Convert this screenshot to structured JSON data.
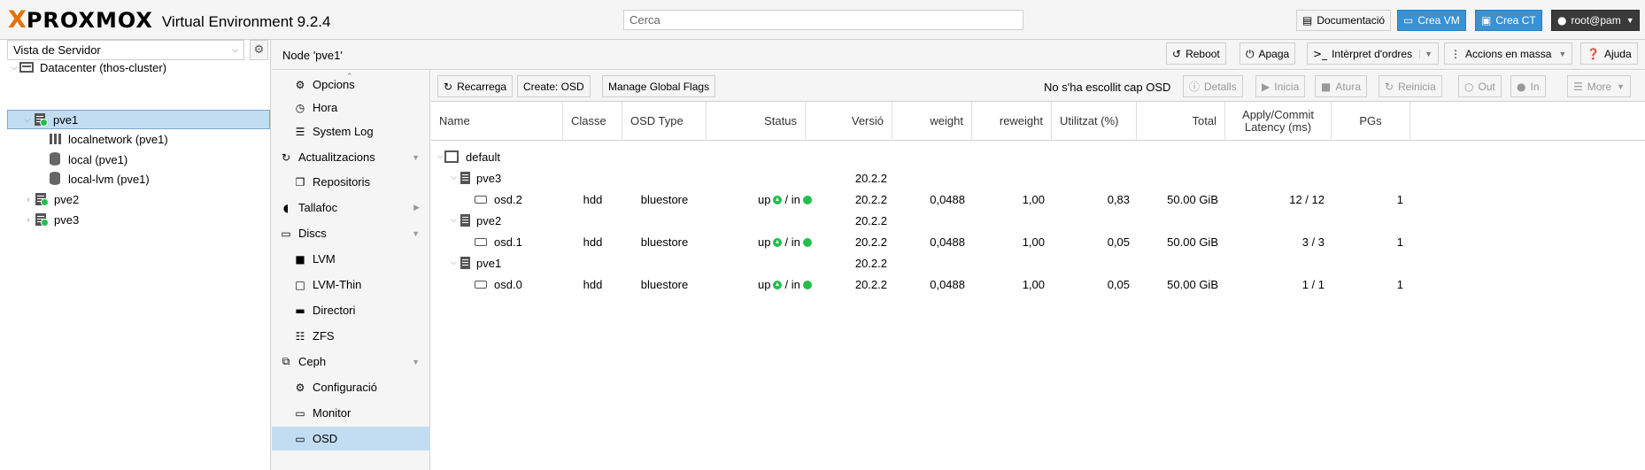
{
  "app": {
    "logo_x": "X",
    "logo_text": "PROXMOX",
    "version_label": "Virtual Environment 9.2.4"
  },
  "header": {
    "search_placeholder": "Cerca",
    "doc_label": "Documentació",
    "create_vm_label": "Crea VM",
    "create_ct_label": "Crea CT",
    "user_label": "root@pam"
  },
  "sidebar": {
    "view_label": "Vista de Servidor",
    "tree": [
      {
        "label": "Datacenter (thos-cluster)",
        "type": "datacenter"
      },
      {
        "label": "pve1",
        "type": "node",
        "selected": true
      },
      {
        "label": "localnetwork (pve1)",
        "type": "network"
      },
      {
        "label": "local (pve1)",
        "type": "storage"
      },
      {
        "label": "local-lvm (pve1)",
        "type": "storage"
      },
      {
        "label": "pve2",
        "type": "node"
      },
      {
        "label": "pve3",
        "type": "node"
      }
    ]
  },
  "node_header": {
    "title": "Node 'pve1'",
    "reboot_label": "Reboot",
    "shutdown_label": "Apaga",
    "shell_label": "Intèrpret d'ordres",
    "bulk_label": "Accions en massa",
    "help_label": "Ajuda"
  },
  "menu": {
    "items": [
      {
        "label": "Opcions",
        "icon": "gear-icon"
      },
      {
        "label": "Hora",
        "icon": "clock-icon"
      },
      {
        "label": "System Log",
        "icon": "list-icon"
      },
      {
        "label": "Actualitzacions",
        "icon": "refresh-icon"
      },
      {
        "label": "Repositoris",
        "icon": "files-icon"
      },
      {
        "label": "Tallafoc",
        "icon": "shield-icon"
      },
      {
        "label": "Discs",
        "icon": "hdd-icon"
      },
      {
        "label": "LVM",
        "icon": "square-icon"
      },
      {
        "label": "LVM-Thin",
        "icon": "square-outline-icon"
      },
      {
        "label": "Directori",
        "icon": "folder-icon"
      },
      {
        "label": "ZFS",
        "icon": "grid-icon"
      },
      {
        "label": "Ceph",
        "icon": "ceph-icon"
      },
      {
        "label": "Configuració",
        "icon": "gear-icon"
      },
      {
        "label": "Monitor",
        "icon": "monitor-icon"
      },
      {
        "label": "OSD",
        "icon": "hdd-icon",
        "selected": true
      }
    ]
  },
  "osd_toolbar": {
    "reload_label": "Recarrega",
    "create_label": "Create: OSD",
    "flags_label": "Manage Global Flags",
    "no_selection_text": "No s'ha escollit cap OSD",
    "details_label": "Detalls",
    "start_label": "Inicia",
    "stop_label": "Atura",
    "restart_label": "Reinicia",
    "out_label": "Out",
    "in_label": "In",
    "more_label": "More"
  },
  "grid": {
    "columns": {
      "name": "Name",
      "class": "Classe",
      "osd_type": "OSD Type",
      "status": "Status",
      "version": "Versió",
      "weight": "weight",
      "reweight": "reweight",
      "used": "Utilitzat (%)",
      "total": "Total",
      "latency_1": "Apply/Commit",
      "latency_2": "Latency (ms)",
      "pgs": "PGs"
    },
    "root": {
      "name": "default"
    },
    "hosts": [
      {
        "name": "pve3",
        "version": "20.2.2",
        "osd": {
          "name": "osd.2",
          "class": "hdd",
          "type": "bluestore",
          "status_up": "up",
          "status_sep": "/ in",
          "version": "20.2.2",
          "weight": "0,0488",
          "reweight": "1,00",
          "used": "0,83",
          "total": "50.00 GiB",
          "latency": "12 / 12",
          "pgs": "1"
        }
      },
      {
        "name": "pve2",
        "version": "20.2.2",
        "osd": {
          "name": "osd.1",
          "class": "hdd",
          "type": "bluestore",
          "status_up": "up",
          "status_sep": "/ in",
          "version": "20.2.2",
          "weight": "0,0488",
          "reweight": "1,00",
          "used": "0,05",
          "total": "50.00 GiB",
          "latency": "3 / 3",
          "pgs": "1"
        }
      },
      {
        "name": "pve1",
        "version": "20.2.2",
        "osd": {
          "name": "osd.0",
          "class": "hdd",
          "type": "bluestore",
          "status_up": "up",
          "status_sep": "/ in",
          "version": "20.2.2",
          "weight": "0,0488",
          "reweight": "1,00",
          "used": "0,05",
          "total": "50.00 GiB",
          "latency": "1 / 1",
          "pgs": "1"
        }
      }
    ]
  }
}
